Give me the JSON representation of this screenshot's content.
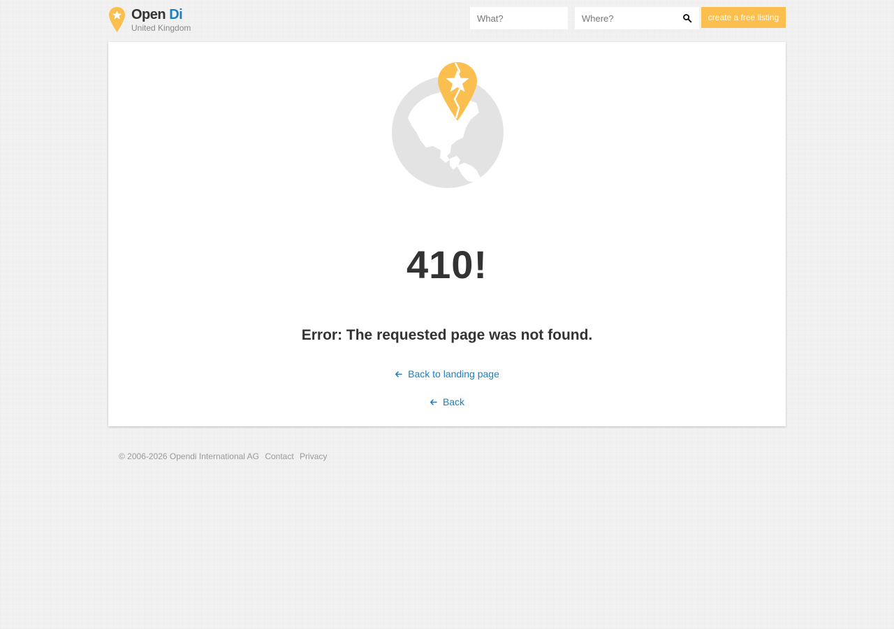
{
  "header": {
    "logo": {
      "name_first": "Open",
      "name_second": "Di",
      "country": "United Kingdom"
    },
    "search": {
      "what_placeholder": "What?",
      "what_value": "",
      "where_placeholder": "Where?",
      "where_value": "",
      "button_icon": "search-icon"
    },
    "cta_label": "create a free listing"
  },
  "error": {
    "illustration": "broken-pin-globe",
    "code": "410!",
    "message": "Error: The requested page was not found.",
    "links": [
      {
        "icon": "arrow-left-icon",
        "label": "Back to landing page"
      },
      {
        "icon": "arrow-left-icon",
        "label": "Back"
      }
    ]
  },
  "footer": {
    "copyright": "© 2006-2026 Opendi International AG",
    "links": [
      "Contact",
      "Privacy"
    ]
  },
  "colors": {
    "brand_blue": "#1a7fc1",
    "accent_yellow": "#fbbf4f",
    "globe_gray": "#e3e3e3",
    "page_background": "#f1f1f1"
  }
}
